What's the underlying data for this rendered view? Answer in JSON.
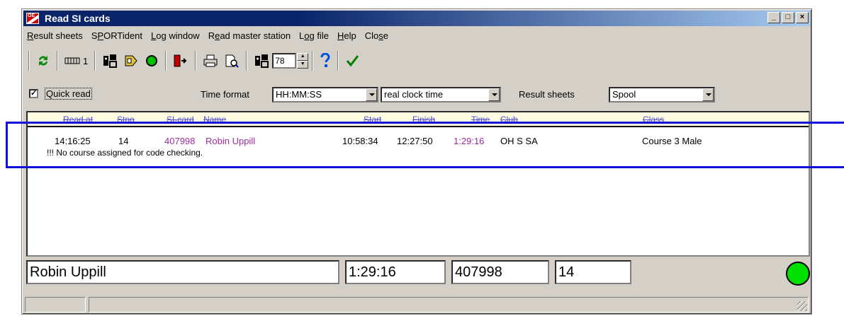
{
  "window": {
    "title": "Read SI cards",
    "app_icon_text": "OE",
    "controls": [
      "_",
      "□",
      "×"
    ]
  },
  "menu": [
    {
      "pre": "",
      "ul": "R",
      "post": "esult sheets"
    },
    {
      "pre": "S",
      "ul": "P",
      "post": "ORTident"
    },
    {
      "pre": "",
      "ul": "L",
      "post": "og window"
    },
    {
      "pre": "R",
      "ul": "e",
      "post": "ad master station"
    },
    {
      "pre": "L",
      "ul": "o",
      "post": "g file"
    },
    {
      "pre": "",
      "ul": "H",
      "post": "elp"
    },
    {
      "pre": "Clo",
      "ul": "s",
      "post": "e"
    }
  ],
  "toolbar": {
    "station_label": "1",
    "spin_value": "78"
  },
  "options": {
    "quick_read_label": "Quick read",
    "quick_read_checked": "✓",
    "time_format_label": "Time format",
    "time_format_value": "HH:MM:SS",
    "time_mode_value": "real clock time",
    "result_sheets_label": "Result sheets",
    "result_sheets_value": "Spool"
  },
  "list": {
    "headers": {
      "read_at": "Read at",
      "stno": "Stno",
      "si_card": "SI-card",
      "name": "Name",
      "start": "Start",
      "finish": "Finish",
      "time": "Time",
      "club": "Club",
      "class": "Class"
    },
    "row": {
      "read_at": "14:16:25",
      "stno": "14",
      "si_card": "407998",
      "name": "Robin Uppill",
      "start": "10:58:34",
      "finish": "12:27:50",
      "time": "1:29:16",
      "club": "OH S SA",
      "class": "Course 3 Male",
      "message": "!!! No course assigned for code checking."
    }
  },
  "summary": {
    "name": "Robin Uppill",
    "time": "1:29:16",
    "si_card": "407998",
    "stno": "14"
  },
  "colors": {
    "title_bar": "#0a246a",
    "highlight_box": "#1010d8",
    "purple_text": "#9c2b9c",
    "status_led": "#00e000"
  }
}
